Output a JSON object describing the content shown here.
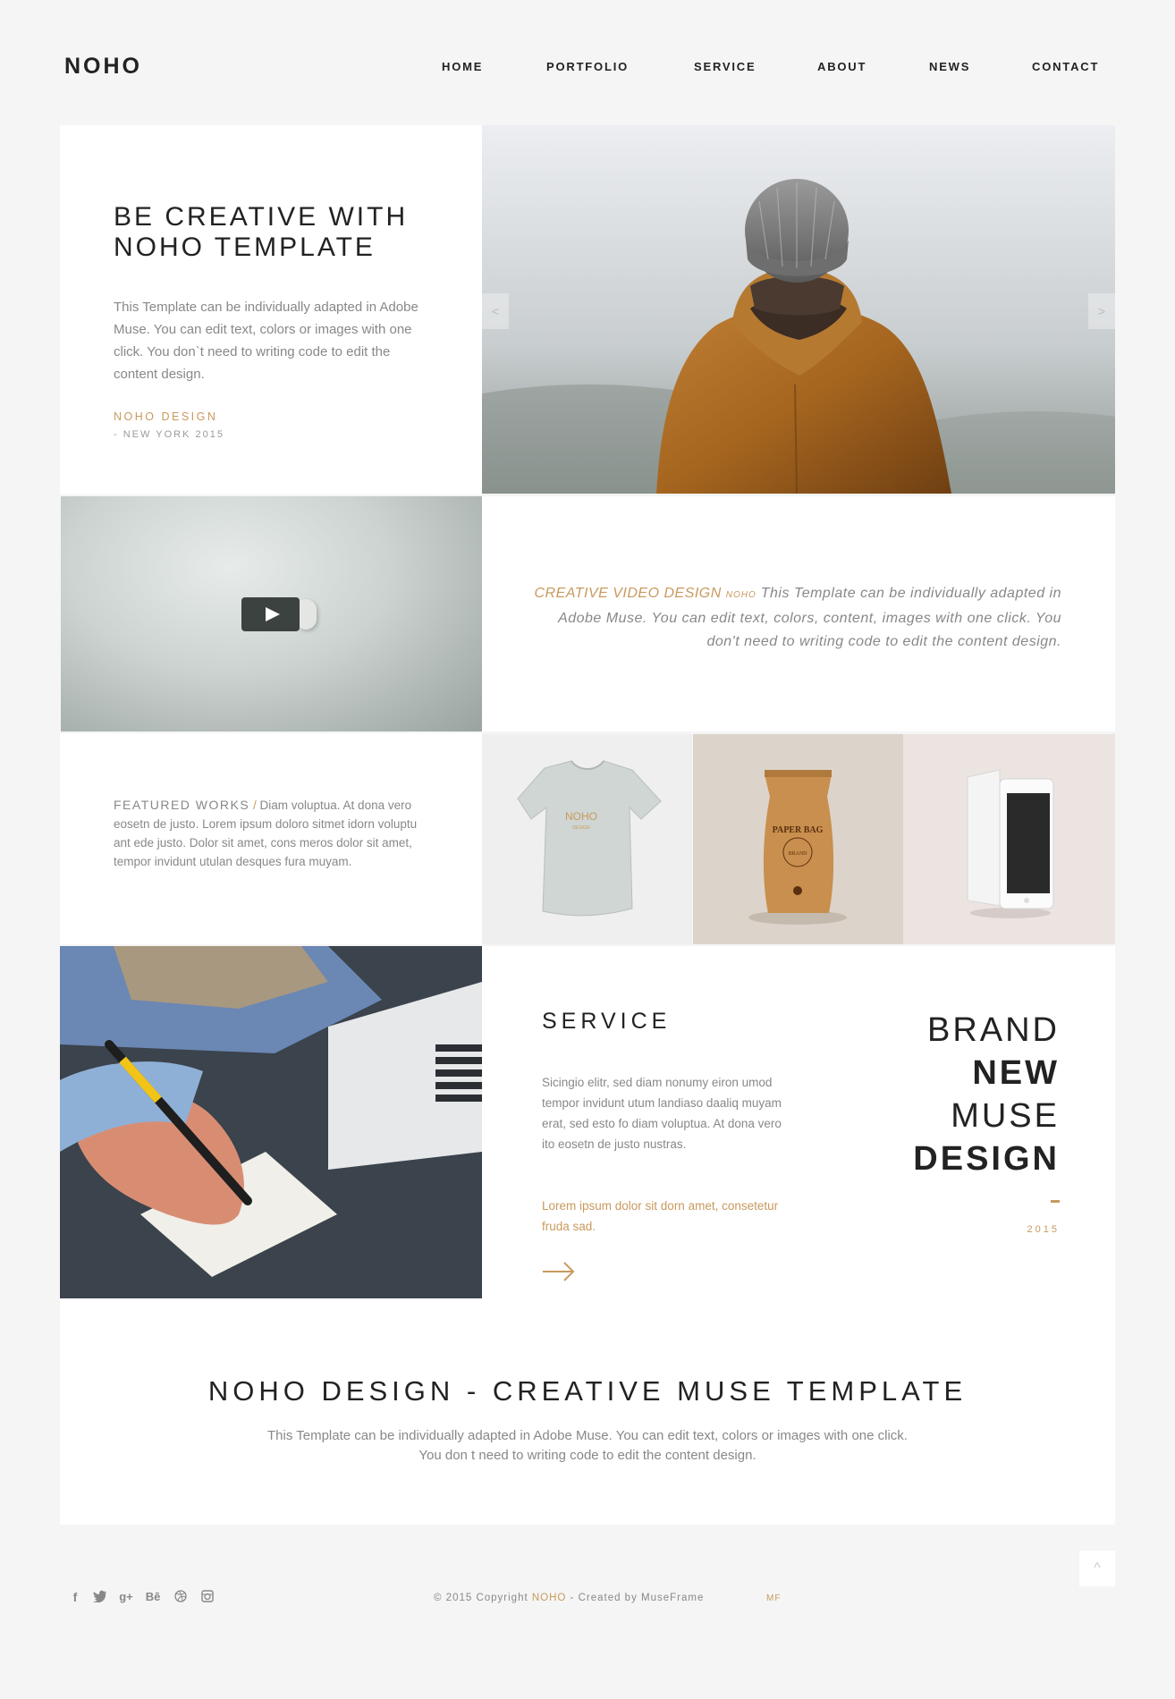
{
  "header": {
    "logo": "NOHO",
    "nav": [
      "HOME",
      "PORTFOLIO",
      "SERVICE",
      "ABOUT",
      "NEWS",
      "CONTACT"
    ]
  },
  "hero": {
    "title_line1": "BE CREATIVE WITH",
    "title_line2": "NOHO TEMPLATE",
    "description": "This Template can be individually adapted in Adobe Muse. You can edit text, colors or images with one click. You don`t need to writing code to edit the content design.",
    "signature": "NOHO DESIGN",
    "signature_sub": "- NEW YORK 2015",
    "prev_arrow": "<",
    "next_arrow": ">"
  },
  "video_section": {
    "accent": "CREATIVE VIDEO DESIGN",
    "small": "NOHO",
    "body": "This Template can be individually adapted in Adobe Muse. You can edit text, colors, content, images with one click. You don't need to writing code to edit the content design."
  },
  "featured": {
    "label": "FEATURED WORKS",
    "slash": "/",
    "text": "Diam voluptua. At dona vero eosetn de justo. Lorem ipsum doloro sitmet idorn voluptu ant ede justo. Dolor sit amet, cons meros dolor sit amet, tempor invidunt utulan desques fura muyam.",
    "tshirt_logo": "NOHO",
    "tshirt_sub": "DESIGN",
    "bag_label": "PAPER BAG",
    "bag_sub": "BRAND"
  },
  "service": {
    "title": "SERVICE",
    "description": "Sicingio elitr, sed diam nonumy eiron umod tempor invidunt utum landiaso daaliq muyam erat, sed esto fo diam voluptua. At dona vero ito eosetn de justo nustras.",
    "accent": "Lorem ipsum dolor sit dorn amet, consetetur fruda sad.",
    "brand": [
      "BRAND",
      "NEW",
      "MUSE",
      "DESIGN"
    ],
    "year": "2015"
  },
  "intro": {
    "title": "NOHO DESIGN - CREATIVE MUSE TEMPLATE",
    "description": "This Template can be individually adapted in Adobe Muse. You can edit text, colors or images with one click. You don t need to writing code to edit the content design."
  },
  "footer": {
    "copy_prefix": "© 2015 Copyright ",
    "copy_brand": "NOHO",
    "copy_suffix": " - Created by MuseFrame",
    "mf": "MF",
    "to_top": "^",
    "social": [
      "facebook-icon",
      "twitter-icon",
      "google-plus-icon",
      "behance-icon",
      "dribbble-icon",
      "instagram-icon"
    ]
  },
  "colors": {
    "accent": "#c9995e",
    "text": "#222222",
    "muted": "#888888",
    "background": "#f5f5f5"
  }
}
